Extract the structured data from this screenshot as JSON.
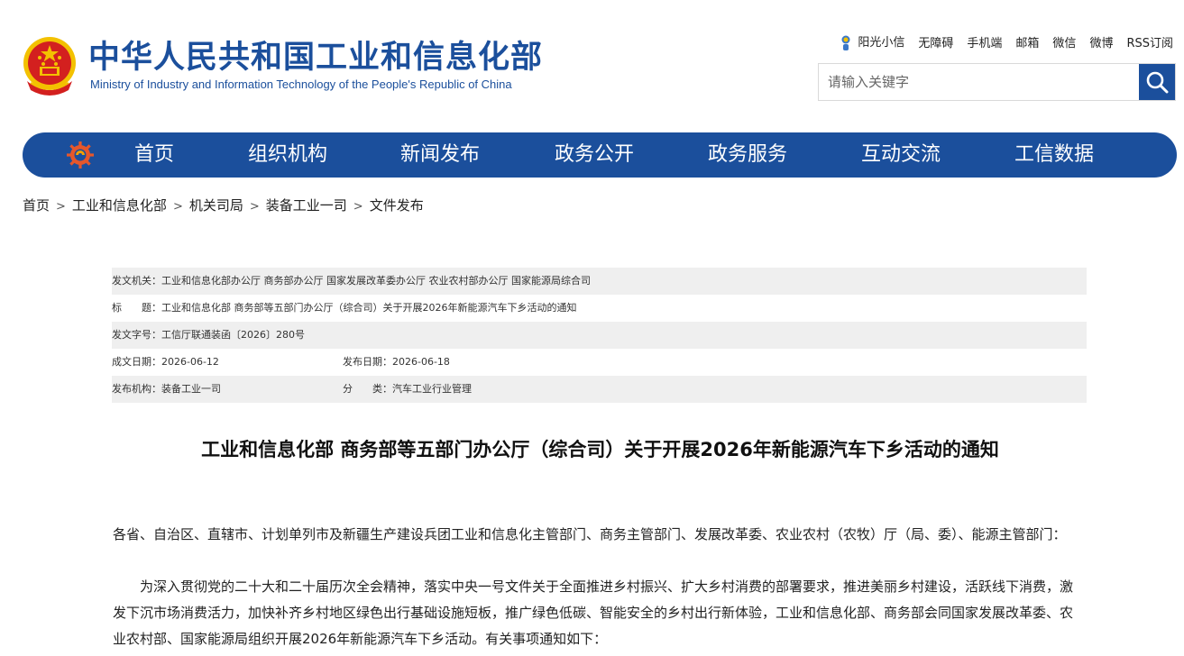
{
  "header": {
    "site_title": "中华人民共和国工业和信息化部",
    "site_subtitle": "Ministry of Industry and Information Technology of the People's Republic of China",
    "top_links": [
      "阳光小信",
      "无障碍",
      "手机端",
      "邮箱",
      "微信",
      "微博",
      "RSS订阅"
    ],
    "search_placeholder": "请输入关键字"
  },
  "nav": {
    "items": [
      "首页",
      "组织机构",
      "新闻发布",
      "政务公开",
      "政务服务",
      "互动交流",
      "工信数据"
    ]
  },
  "breadcrumb": [
    "首页",
    "工业和信息化部",
    "机关司局",
    "装备工业一司",
    "文件发布"
  ],
  "meta": {
    "issuer_label": "发文机关：",
    "issuer": "工业和信息化部办公厅 商务部办公厅 国家发展改革委办公厅 农业农村部办公厅 国家能源局综合司",
    "title_label": "标　　题：",
    "title": "工业和信息化部 商务部等五部门办公厅（综合司）关于开展2026年新能源汽车下乡活动的通知",
    "doc_no_label": "发文字号：",
    "doc_no": "工信厅联通装函〔2026〕280号",
    "created_label": "成文日期：",
    "created": "2026-06-12",
    "published_label": "发布日期：",
    "published": "2026-06-18",
    "org_label": "发布机构：",
    "org": "装备工业一司",
    "category_label": "分　　类：",
    "category": "汽车工业行业管理"
  },
  "article": {
    "title": "工业和信息化部 商务部等五部门办公厅（综合司）关于开展2026年新能源汽车下乡活动的通知",
    "paragraphs": [
      "各省、自治区、直辖市、计划单列市及新疆生产建设兵团工业和信息化主管部门、商务主管部门、发展改革委、农业农村（农牧）厅（局、委）、能源主管部门：",
      "为深入贯彻党的二十大和二十届历次全会精神，落实中央一号文件关于全面推进乡村振兴、扩大乡村消费的部署要求，推进美丽乡村建设，活跃线下消费，激发下沉市场消费活力，加快补齐乡村地区绿色出行基础设施短板，推广绿色低碳、智能安全的乡村出行新体验，工业和信息化部、商务部会同国家发展改革委、农业农村部、国家能源局组织开展2026年新能源汽车下乡活动。有关事项通知如下："
    ]
  },
  "colors": {
    "brand_blue": "#1b4f9c",
    "emblem_red": "#d3201f",
    "emblem_gold": "#f3c100",
    "meta_row_bg": "#efefef"
  }
}
